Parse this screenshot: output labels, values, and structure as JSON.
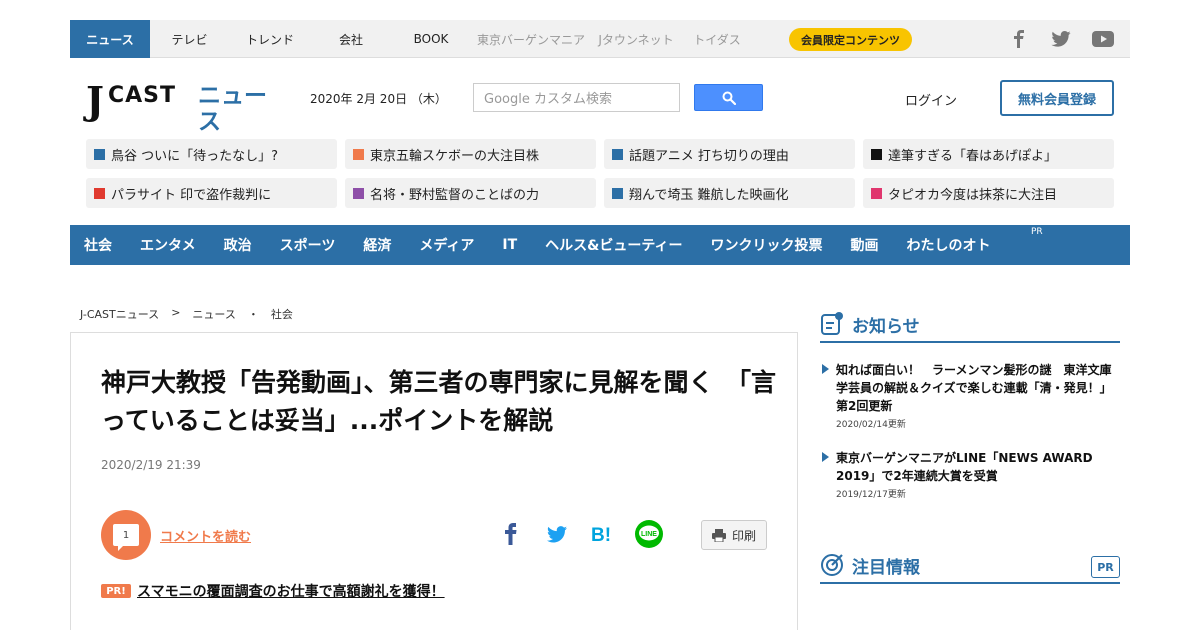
{
  "topbar": {
    "items": [
      {
        "label": "ニュース"
      },
      {
        "label": "テレビ"
      },
      {
        "label": "トレンド"
      },
      {
        "label": "会社"
      },
      {
        "label": "BOOK"
      },
      {
        "label": "東京バーゲンマニア"
      },
      {
        "label": "Jタウンネット"
      },
      {
        "label": "トイダス"
      }
    ],
    "member_label": "会員限定コンテンツ",
    "social_icons": [
      "facebook-icon",
      "twitter-icon",
      "youtube-icon"
    ]
  },
  "header": {
    "logo_j": "J",
    "logo_cast": "CAST",
    "logo_news": "ニュース",
    "date": "2020年 2月 20日 （木）",
    "search_placeholder": "Google カスタム検索",
    "login": "ログイン",
    "register": "無料会員登録"
  },
  "topics": [
    {
      "label": "鳥谷 ついに「待ったなし」?",
      "color": "#2c6fa6"
    },
    {
      "label": "東京五輪スケボーの大注目株",
      "color": "#f07a4b"
    },
    {
      "label": "話題アニメ 打ち切りの理由",
      "color": "#2c6fa6"
    },
    {
      "label": "達筆すぎる「春はあげぽよ」",
      "color": "#111111"
    },
    {
      "label": "パラサイト 印で盗作裁判に",
      "color": "#e03a2f"
    },
    {
      "label": "名将・野村監督のことばの力",
      "color": "#8e4fa8"
    },
    {
      "label": "翔んで埼玉 難航した映画化",
      "color": "#2c6fa6"
    },
    {
      "label": "タピオカ今度は抹茶に大注目",
      "color": "#e0366e"
    }
  ],
  "categories": [
    {
      "label": "社会"
    },
    {
      "label": "エンタメ"
    },
    {
      "label": "政治"
    },
    {
      "label": "スポーツ"
    },
    {
      "label": "経済"
    },
    {
      "label": "メディア"
    },
    {
      "label": "IT"
    },
    {
      "label": "ヘルス&ビューティー"
    },
    {
      "label": "ワンクリック投票"
    },
    {
      "label": "動画"
    },
    {
      "label": "わたしのオト"
    }
  ],
  "category_pr": "PR",
  "breadcrumb": [
    "J-CASTニュース",
    ">",
    "ニュース",
    "・",
    "社会"
  ],
  "article": {
    "title": "神戸大教授「告発動画」、第三者の専門家に見解を聞く　「言っていることは妥当」...ポイントを解説",
    "posted": "2020/2/19 21:39",
    "comment_count": "1",
    "comment_link": "コメントを読む",
    "print_label": "印刷",
    "pr_tag": "PR!",
    "pr_link": "スマモニの覆面調査のお仕事で高額謝礼を獲得！"
  },
  "sidebar": {
    "notice_title": "お知らせ",
    "notices": [
      {
        "text": "知れば面白い！　ラーメンマン髪形の謎　東洋文庫学芸員の解説＆クイズで楽しむ連載「清・発見！」第2回更新",
        "date": "2020/02/14更新"
      },
      {
        "text": "東京バーゲンマニアがLINE「NEWS AWARD 2019」で2年連続大賞を受賞",
        "date": "2019/12/17更新"
      }
    ],
    "attention_title": "注目情報",
    "attention_pr": "PR"
  },
  "colors": {
    "brand_blue": "#2c6fa6",
    "accent_orange": "#f07a4b",
    "member_yellow": "#f8c400"
  }
}
